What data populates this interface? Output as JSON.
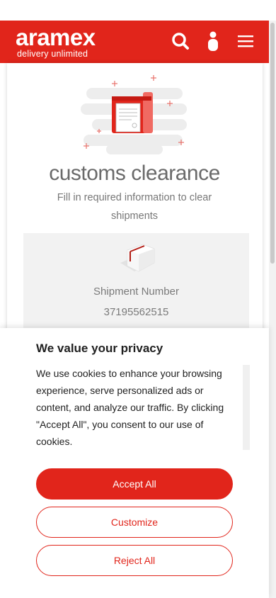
{
  "header": {
    "logo_word": "aramex",
    "logo_tagline": "delivery unlimited",
    "icons": [
      "search-icon",
      "user-icon",
      "menu-icon"
    ]
  },
  "hero": {
    "title": "customs clearance",
    "subtitle": "Fill in required information to clear shipments"
  },
  "shipment": {
    "label": "Shipment Number",
    "number": "37195562515"
  },
  "cookie_banner": {
    "title": "We value your privacy",
    "text": "We use cookies to enhance your browsing experience, serve personalized ads or content, and analyze our traffic. By clicking \"Accept All\", you consent to our use of cookies.",
    "accept_label": "Accept All",
    "customize_label": "Customize",
    "reject_label": "Reject All"
  },
  "colors": {
    "brand_red": "#e1251b",
    "panel_grey": "#f2f2f2",
    "text_grey": "#777777"
  }
}
